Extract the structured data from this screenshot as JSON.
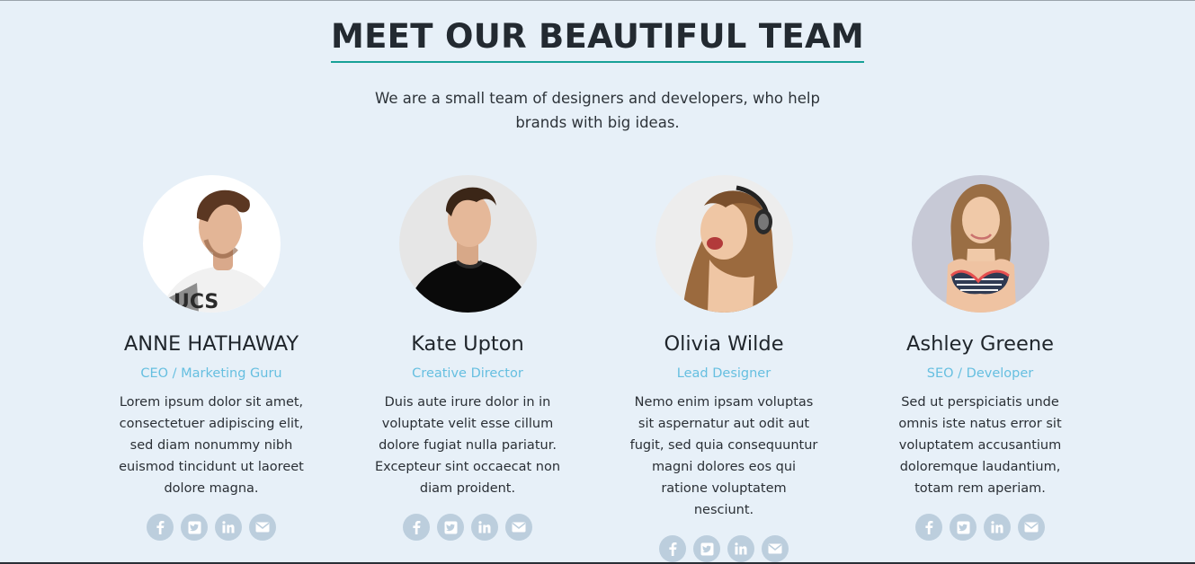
{
  "header": {
    "title": "MEET OUR BEAUTIFUL TEAM",
    "subtitle_line1": "We are a small team of designers and developers, who help",
    "subtitle_line2": "brands with big ideas."
  },
  "colors": {
    "background": "#e7f0f8",
    "title_underline": "#17a197",
    "role_text": "#66bfe0",
    "social_icon_bg": "#bccedd"
  },
  "members": [
    {
      "name": "ANNE HATHAWAY",
      "role": "CEO / Marketing Guru",
      "bio": "Lorem ipsum dolor sit amet, consectetuer adipiscing elit, sed diam nonummy nibh euismod tincidunt ut laoreet dolore magna.",
      "social": [
        "facebook-icon",
        "twitter-icon",
        "linkedin-icon",
        "envelope-icon"
      ]
    },
    {
      "name": "Kate Upton",
      "role": "Creative Director",
      "bio": "Duis aute irure dolor in in voluptate velit esse cillum dolore fugiat nulla pariatur. Excepteur sint occaecat non diam proident.",
      "social": [
        "facebook-icon",
        "twitter-icon",
        "linkedin-icon",
        "envelope-icon"
      ]
    },
    {
      "name": "Olivia Wilde",
      "role": "Lead Designer",
      "bio": "Nemo enim ipsam voluptas sit aspernatur aut odit aut fugit, sed quia consequuntur magni dolores eos qui ratione voluptatem nesciunt.",
      "social": [
        "facebook-icon",
        "twitter-icon",
        "linkedin-icon",
        "envelope-icon"
      ]
    },
    {
      "name": "Ashley Greene",
      "role": "SEO / Developer",
      "bio": "Sed ut perspiciatis unde omnis iste natus error sit voluptatem accusantium doloremque laudantium, totam rem aperiam.",
      "social": [
        "facebook-icon",
        "twitter-icon",
        "linkedin-icon",
        "envelope-icon"
      ]
    }
  ]
}
